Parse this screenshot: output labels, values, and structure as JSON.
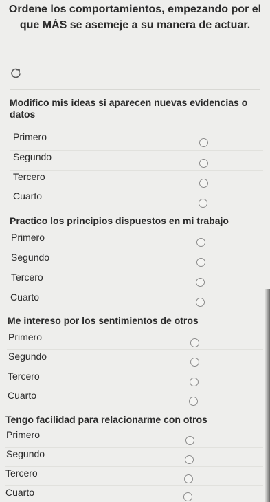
{
  "header": {
    "instruction": "Ordene los comportamientos, empezando por el que MÁS se asemeje a su manera de actuar."
  },
  "reset_icon": "refresh-icon",
  "questions": [
    {
      "text": "Modifico mis ideas si aparecen nuevas evidencias o datos",
      "options": [
        "Primero",
        "Segundo",
        "Tercero",
        "Cuarto"
      ]
    },
    {
      "text": "Practico los principios dispuestos en mi trabajo",
      "options": [
        "Primero",
        "Segundo",
        "Tercero",
        "Cuarto"
      ]
    },
    {
      "text": "Me intereso por los sentimientos de otros",
      "options": [
        "Primero",
        "Segundo",
        "Tercero",
        "Cuarto"
      ]
    },
    {
      "text": "Tengo facilidad para relacionarme con otros",
      "options": [
        "Primero",
        "Segundo",
        "Tercero",
        "Cuarto"
      ]
    }
  ]
}
